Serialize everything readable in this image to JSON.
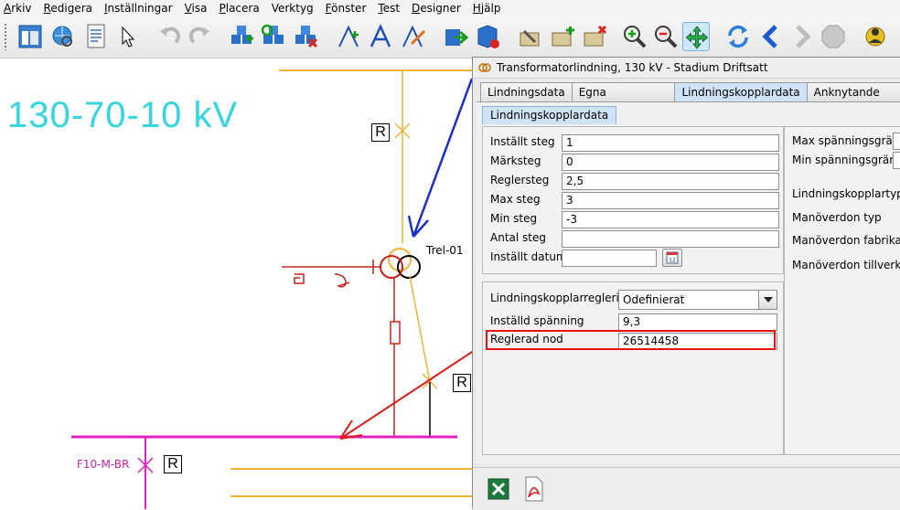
{
  "menu": {
    "items": [
      {
        "key": "A",
        "rest": "rkiv"
      },
      {
        "key": "R",
        "rest": "edigera"
      },
      {
        "key": "I",
        "rest": "nställningar"
      },
      {
        "key": "V",
        "rest": "isa"
      },
      {
        "key": "P",
        "rest": "lacera"
      },
      {
        "key": "",
        "rest": "Verktyg"
      },
      {
        "key": "F",
        "rest": "önster"
      },
      {
        "key": "T",
        "rest": "est"
      },
      {
        "key": "D",
        "rest": "esigner"
      },
      {
        "key": "H",
        "rest": "jälp"
      }
    ]
  },
  "diagram": {
    "voltage_label": "130-70-10 kV",
    "transformer_label": "Trel-01",
    "feeder_label": "F10-M-BR",
    "r_marker": "R",
    "colors": {
      "bus_130": "#f2b233",
      "bus_10": "#e020c0",
      "feeder": "#cc2020",
      "voltage_text": "#35d6df",
      "blue_arrow": "#1b2fd0",
      "red_arrow": "#e01818"
    }
  },
  "dialog": {
    "title": "Transformatorlindning, 130 kV - Stadium Driftsatt",
    "tabs": [
      "Lindningsdata",
      "Egna lindningsdata",
      "Lindningskopplardata",
      "Anknytande data"
    ],
    "active_tab": "Lindningskopplardata",
    "subtab": "Lindningskopplardata",
    "fields": {
      "installt_steg": {
        "label": "Inställt steg",
        "value": "1"
      },
      "marksteg": {
        "label": "Märksteg",
        "value": "0"
      },
      "reglersteg": {
        "label": "Reglersteg",
        "value": "2,5"
      },
      "max_steg": {
        "label": "Max steg",
        "value": "3"
      },
      "min_steg": {
        "label": "Min steg",
        "value": "-3"
      },
      "antal_steg": {
        "label": "Antal steg",
        "value": ""
      },
      "installt_datum": {
        "label": "Inställt datum",
        "value": ""
      },
      "reglering": {
        "label": "Lindningskopplarreglering",
        "value": "Odefinierat"
      },
      "installd_spanning": {
        "label": "Inställd spänning",
        "value": "9,3"
      },
      "reglerad_nod": {
        "label": "Reglerad nod",
        "value": "26514458"
      }
    },
    "right_labels": {
      "max_spanningsgrans": "Max spänningsgräns",
      "min_spanningsgrans": "Min spänningsgräns",
      "lindningskopplartyp": "Lindningskopplartyp",
      "manoverdon_typ": "Manöverdon typ",
      "manoverdon_fabrikat": "Manöverdon fabrikat",
      "manoverdon_tillverkning": "Manöverdon tillverkni"
    },
    "highlight_color": "#e11111"
  }
}
